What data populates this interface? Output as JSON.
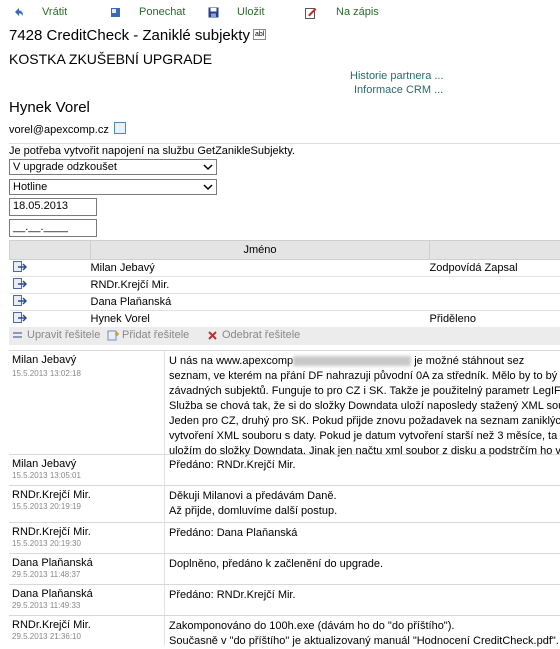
{
  "toolbar": {
    "back_label": "Vrátit",
    "keep_label": "Ponechat",
    "save_label": "Uložit",
    "visit_label": "Na zápis"
  },
  "header": {
    "title": "7428 CreditCheck - Zaniklé subjekty",
    "abl": "abl",
    "subtitle": "KOSTKA ZKUŠEBNÍ UPGRADE",
    "partner_history": "Historie partnera ...",
    "crm_info": "Informace CRM ..."
  },
  "contact": {
    "name": "Hynek Vorel",
    "email": "vorel@apexcomp.cz"
  },
  "request": {
    "description": "Je potřeba vytvořit napojení na službu GetZanikleSubjekty.",
    "status_value": "V upgrade odzkoušet",
    "category_value": "Hotline",
    "date_value": "18.05.2013",
    "time_value": "__.__.____"
  },
  "resolvers": {
    "column_header": "Jméno",
    "rows": [
      {
        "name": "Milan Jebavý",
        "status": "Zodpovídá Zapsal"
      },
      {
        "name": "RNDr.Krejčí Mir.",
        "status": ""
      },
      {
        "name": "Dana Plaňanská",
        "status": ""
      },
      {
        "name": "Hynek Vorel",
        "status": "Přiděleno"
      }
    ],
    "edit_label": "Upravit řešitele",
    "add_label": "Přidat řešitele",
    "remove_label": "Odebrat řešitele"
  },
  "log": [
    {
      "who": "Milan Jebavý",
      "when": "15.5.2013 13:02:18",
      "lines": [
        "U nás na www.apexcomp",
        "je možné stáhnout sez",
        "seznam, ve kterém na přání DF nahrazuji původní 0A za středník. Mělo by to bý",
        "závadných subjektů. Funguje to pro CZ i SK. Takže je použitelný parametr LegIF",
        "Služba se chová tak, že si do složky Downdata uloží naposledy stažený XML sou",
        "Jeden pro CZ, druhý pro SK. Pokud přijde znovu požadavek na seznam zaniklýcl",
        "vytvoření XML souboru s daty. Pokud je datum vytvoření starší než 3 měsíce, ta",
        "uložím do složky Downdata. Jinak jen načtu xml soubor z disku a podstrčím ho v"
      ]
    },
    {
      "who": "Milan Jebavý",
      "when": "15.5.2013 13:05:01",
      "lines": [
        "Předáno: RNDr.Krejčí Mir."
      ]
    },
    {
      "who": "RNDr.Krejčí Mir.",
      "when": "15.5.2013 20:19:19",
      "lines": [
        "Děkuji Milanovi a předávám Daně.",
        "Až přijde, domluvíme další postup."
      ]
    },
    {
      "who": "RNDr.Krejčí Mir.",
      "when": "15.5.2013 20:19:30",
      "lines": [
        "Předáno: Dana Plaňanská"
      ]
    },
    {
      "who": "Dana Plaňanská",
      "when": "29.5.2013 11:48:37",
      "lines": [
        "Doplněno, předáno k začlenění do upgrade."
      ]
    },
    {
      "who": "Dana Plaňanská",
      "when": "29.5.2013 11:49:33",
      "lines": [
        "Předáno: RNDr.Krejčí Mir."
      ]
    },
    {
      "who": "RNDr.Krejčí Mir.",
      "when": "29.5.2013 21:36:10",
      "lines": [
        "Zakomponováno do 100h.exe (dávám ho do \"do příštího\").",
        "Současně v \"do příštího\" je aktualizovaný manuál \"Hodnocení CreditCheck.pdf\"."
      ]
    }
  ]
}
